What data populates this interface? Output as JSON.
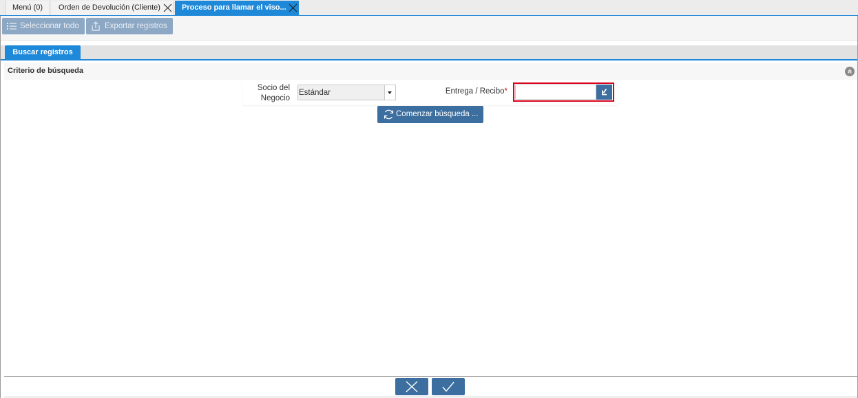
{
  "tabs": [
    {
      "label": "Menú (0)",
      "closable": false
    },
    {
      "label": "Orden de Devolución (Cliente)",
      "closable": true
    },
    {
      "label": "Proceso para llamar el viso...",
      "closable": true,
      "active": true
    }
  ],
  "toolbar": {
    "select_all_label": "Seleccionar todo",
    "export_label": "Exportar registros"
  },
  "section_tab": {
    "label": "Buscar registros"
  },
  "search_group": {
    "title": "Criterio de búsqueda",
    "fields": {
      "business_partner": {
        "label": "Socio del Negocio",
        "value": "Estándar"
      },
      "delivery": {
        "label": "Entrega / Recibo",
        "required_mark": "*",
        "value": ""
      }
    },
    "start_button_label": "Comenzar búsqueda ..."
  },
  "colors": {
    "accent": "#1e88d9",
    "button_dark": "#3c6e9f",
    "button_disabled": "#8da8c4",
    "highlight": "#d8001a",
    "required": "#dd0000"
  },
  "icons": {
    "tab_close": "close-icon",
    "select_all": "list-icon",
    "export": "export-icon",
    "collapse": "collapse-icon",
    "lookup": "lookup-icon",
    "refresh": "refresh-icon",
    "cancel": "close-icon",
    "ok": "check-icon"
  }
}
